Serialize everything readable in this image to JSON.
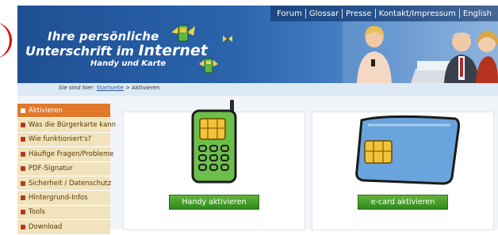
{
  "topnav": {
    "items": [
      "Forum",
      "Glossar",
      "Presse",
      "Kontakt/Impressum",
      "English"
    ]
  },
  "banner": {
    "line1": "Ihre persönliche",
    "line2_a": "Unterschrift",
    "line2_b": " im ",
    "line2_c": "Internet",
    "line3": "Handy und Karte"
  },
  "breadcrumb": {
    "prefix": "Sie sind hier:",
    "home": "Startseite",
    "separator": " > ",
    "current": "Aktivieren"
  },
  "sidebar": {
    "items": [
      "Aktivieren",
      "Was die Bürgerkarte kann",
      "Wie funktioniert's?",
      "Häufige Fragen/Probleme",
      "PDF-Signatur",
      "Sicherheit / Datenschutz",
      "Hintergrund-Infos",
      "Tools",
      "Download"
    ],
    "active_index": 0
  },
  "cards": {
    "handy_button": "Handy aktivieren",
    "ecard_button": "e-card aktivieren"
  },
  "colors": {
    "banner": "#2a64ab",
    "sidebar_active": "#e1782a",
    "sidebar_item": "#f1e3bd",
    "button_green": "#3c9a28"
  }
}
